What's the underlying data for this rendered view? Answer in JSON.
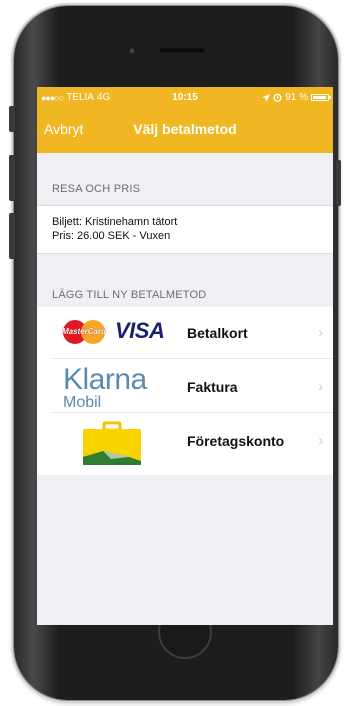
{
  "status_bar": {
    "carrier": "TELIA",
    "network": "4G",
    "time": "10:15",
    "battery": "91 %",
    "battery_level": 0.91
  },
  "nav": {
    "cancel_label": "Avbryt",
    "title": "Välj betalmetod"
  },
  "sections": {
    "trip": {
      "header": "RESA OCH PRIS",
      "ticket_line": "Biljett: Kristinehamn tätort",
      "price_line": "Pris: 26.00 SEK - Vuxen"
    },
    "add_method": {
      "header": "LÄGG TILL NY BETALMETOD",
      "items": [
        {
          "label": "Betalkort",
          "logo": "mastercard-visa-logo",
          "logo_text_1": "MasterCard",
          "logo_text_2": "VISA"
        },
        {
          "label": "Faktura",
          "logo": "klarna-mobil-logo",
          "logo_text_1": "Klarna",
          "logo_text_2": "Mobil"
        },
        {
          "label": "Företagskonto",
          "logo": "briefcase-icon"
        }
      ]
    }
  },
  "colors": {
    "accent": "#f0b722",
    "background": "#efeff4",
    "chevron": "#c7c7cc"
  }
}
